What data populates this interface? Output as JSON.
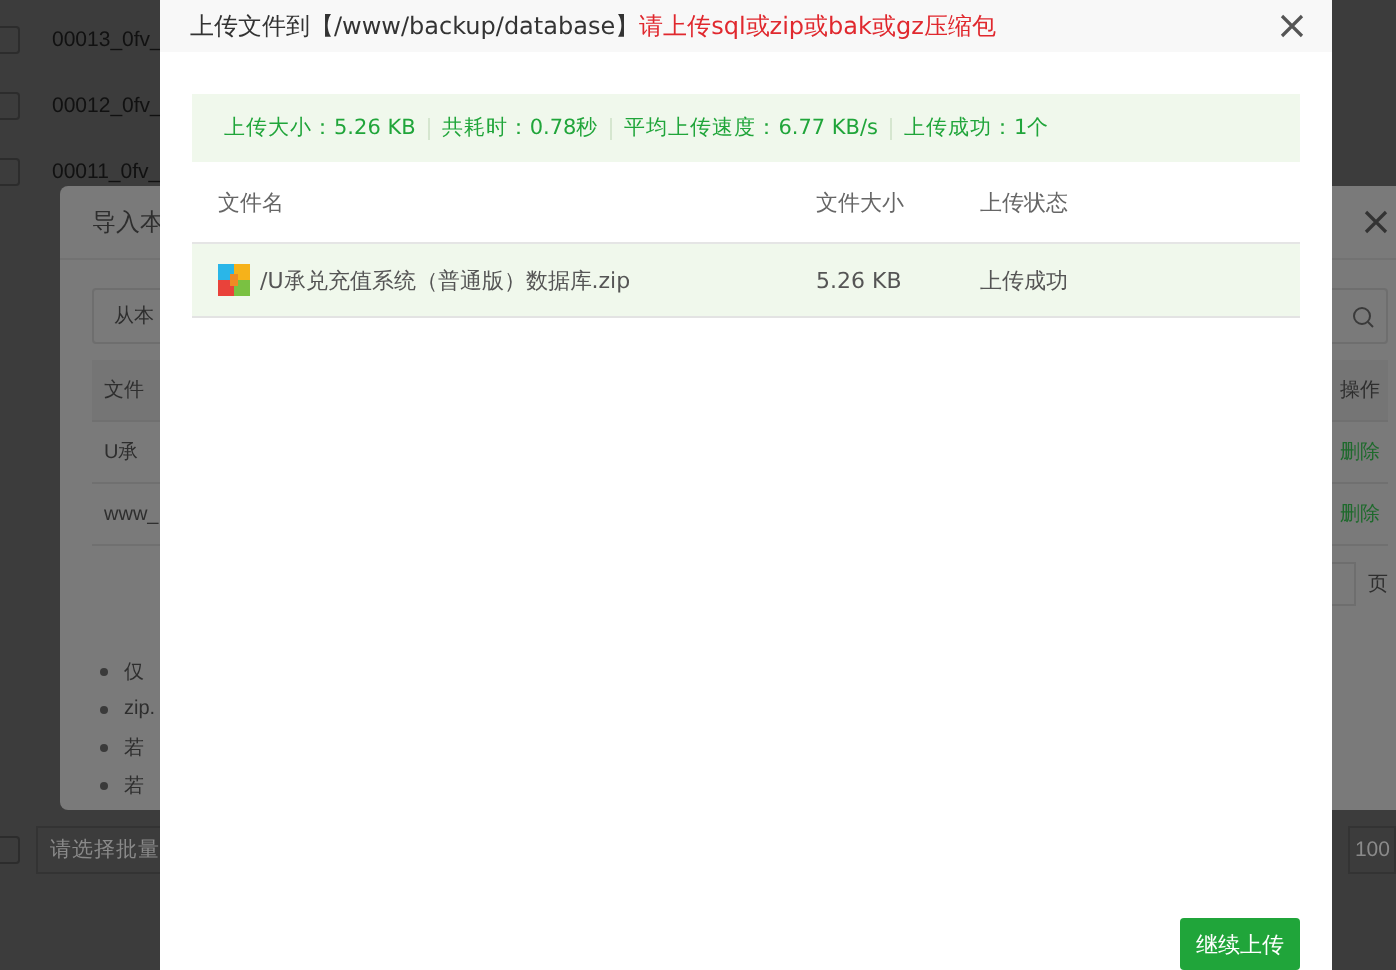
{
  "background_page": {
    "rows": [
      {
        "name": "00013_0fv_",
        "checked": false
      },
      {
        "name": "00012_0fv_",
        "checked": false
      },
      {
        "name": "00011_0fv_",
        "checked": false
      }
    ],
    "select_all_checked": false,
    "batch_placeholder": "请选择批量",
    "page_size": "100"
  },
  "import_dialog": {
    "title": "导入本",
    "source_field": "从本",
    "columns": [
      "文件",
      "操作"
    ],
    "rows": [
      {
        "name": "U承",
        "action": "删除"
      },
      {
        "name": "www_",
        "action": "删除"
      }
    ],
    "page_suffix": "页",
    "notes": [
      "仅",
      "zip.",
      "若",
      "若"
    ]
  },
  "upload_dialog": {
    "title": "上传文件到【/www/backup/database】",
    "hint": "请上传sql或zip或bak或gz压缩包",
    "summary": [
      "上传大小：5.26 KB",
      "共耗时：0.78秒",
      "平均上传速度：6.77 KB/s",
      "上传成功：1个"
    ],
    "columns": [
      "文件名",
      "文件大小",
      "上传状态"
    ],
    "files": [
      {
        "name": "/U承兑充值系统（普通版）数据库.zip",
        "size": "5.26 KB",
        "status": "上传成功"
      }
    ],
    "button": "继续上传"
  }
}
